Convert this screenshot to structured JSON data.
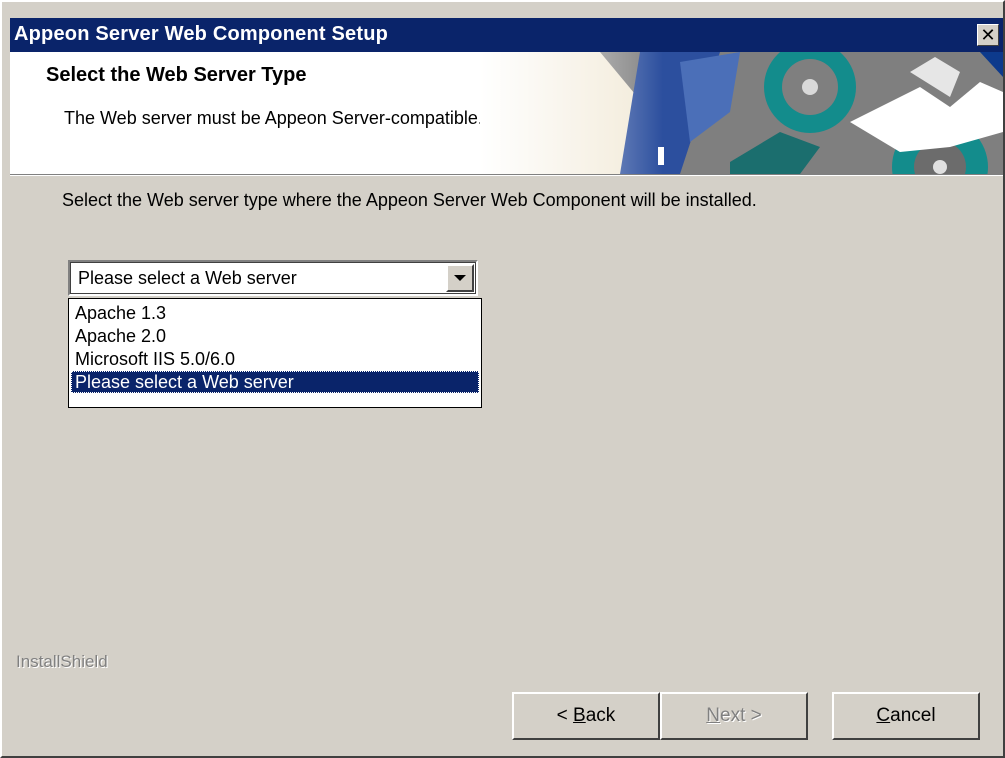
{
  "window": {
    "title": "Appeon Server Web Component Setup",
    "close_glyph": "✕"
  },
  "header": {
    "heading": "Select the Web Server Type",
    "subheading": "The Web server must be Appeon Server-compatible."
  },
  "main": {
    "instruction": "Select the Web server type where the Appeon Server Web Component will be installed.",
    "webserver_select": {
      "value": "Please select a Web server",
      "options": [
        "Apache 1.3",
        "Apache 2.0",
        "Microsoft IIS 5.0/6.0",
        "Please select a Web server"
      ],
      "selected_index": 3
    }
  },
  "footer": {
    "brand": "InstallShield",
    "buttons": {
      "back": {
        "prefix": "< ",
        "accel": "B",
        "rest": "ack",
        "enabled": true
      },
      "next": {
        "accel": "N",
        "rest": "ext >",
        "enabled": false
      },
      "cancel": {
        "accel": "C",
        "rest": "ancel",
        "enabled": true
      }
    }
  },
  "colors": {
    "title_bar": "#0a246a",
    "dialog_face": "#d4d0c8",
    "selection": "#0a246a",
    "header_art_teal": "#138c8c",
    "header_art_blue": "#2c4f9e"
  },
  "icons": {
    "close": "close-icon",
    "dropdown": "chevron-down-icon",
    "header_art": "gears-graphic"
  }
}
